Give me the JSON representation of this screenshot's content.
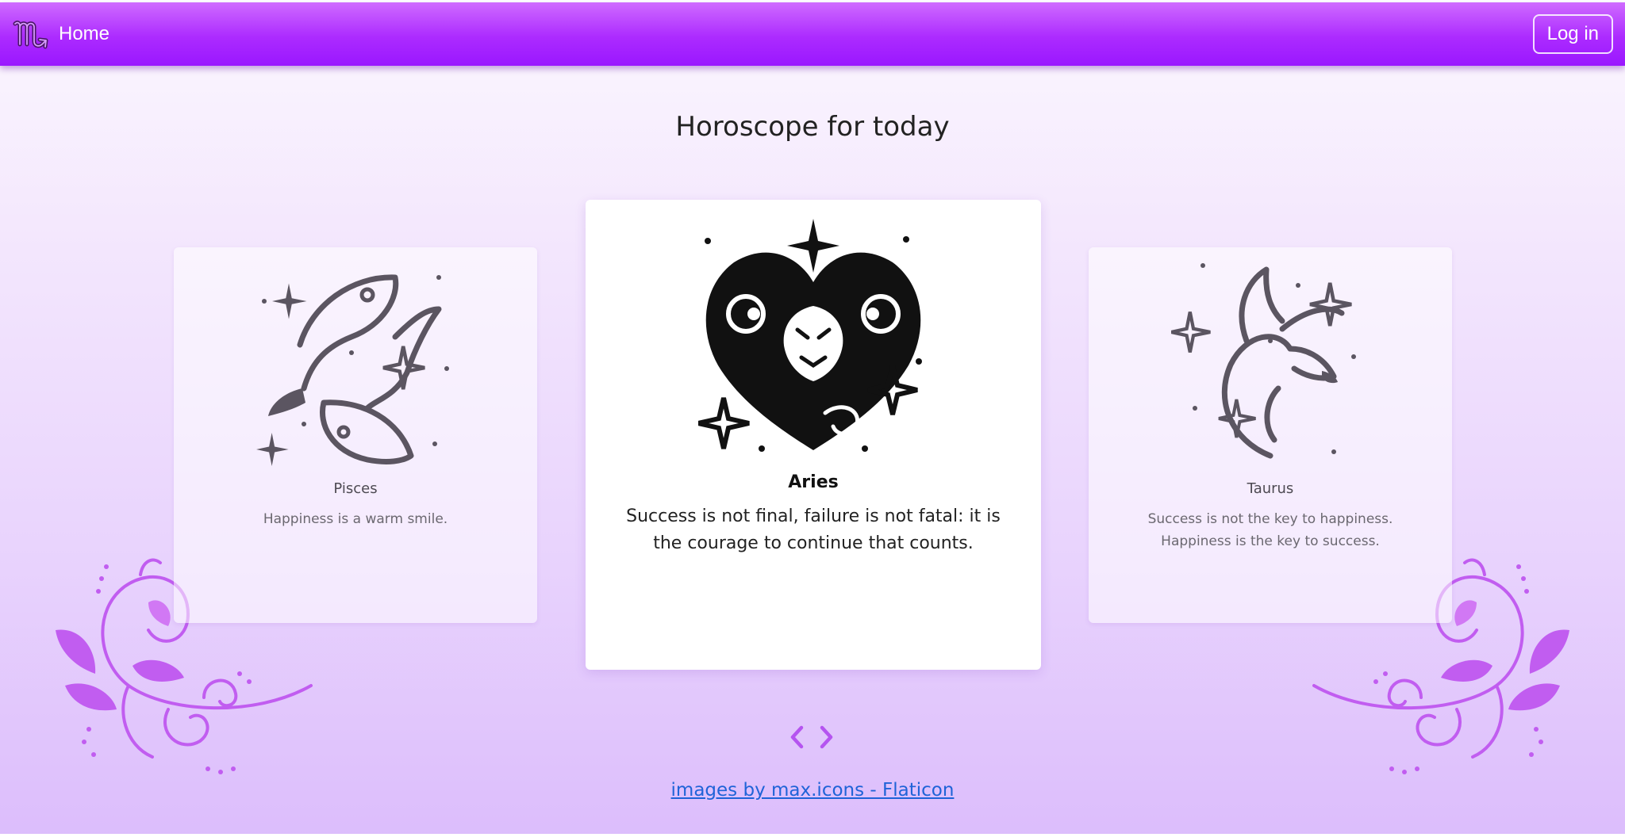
{
  "nav": {
    "brand_label": "Home",
    "login_label": "Log in"
  },
  "page": {
    "title": "Horoscope for today"
  },
  "cards": {
    "left": {
      "sign": "Pisces",
      "text": "Happiness is a warm smile."
    },
    "center": {
      "sign": "Aries",
      "text": "Success is not final, failure is not fatal: it is the courage to continue that counts."
    },
    "right": {
      "sign": "Taurus",
      "text": "Success is not the key to happiness. Happiness is the key to success."
    }
  },
  "carousel": {
    "prev_icon": "chevron-left-icon",
    "next_icon": "chevron-right-icon"
  },
  "footer": {
    "credit_link": "images by max.icons - Flaticon"
  },
  "colors": {
    "nav_top": "#cf6bff",
    "nav_bottom": "#9a17ff",
    "accent": "#b554f0",
    "side_icon": "#5b5561",
    "link": "#1f63d8"
  },
  "icons": {
    "brand": "scorpio-glyph-icon",
    "pisces": "pisces-fish-icon",
    "aries": "aries-ram-icon",
    "taurus": "taurus-bull-icon",
    "ornament": "swirl-ornament"
  }
}
